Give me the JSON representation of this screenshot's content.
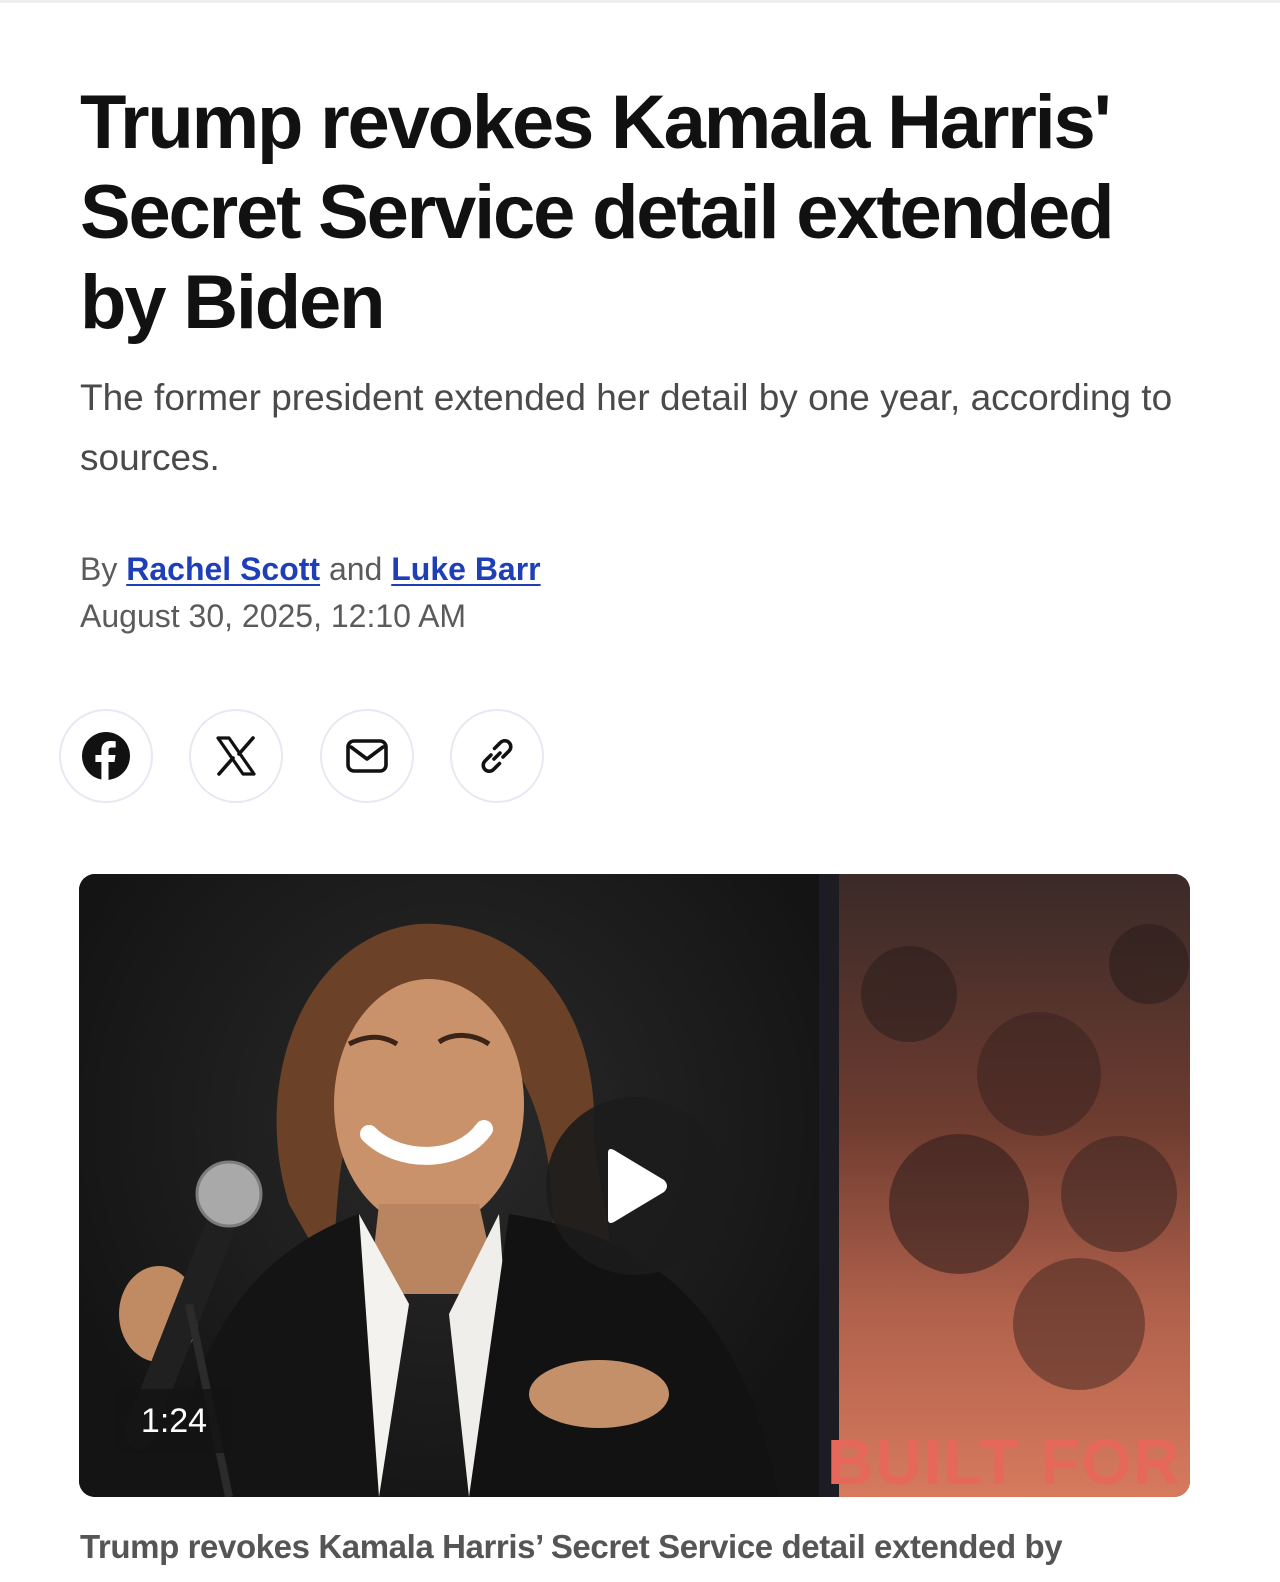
{
  "article": {
    "headline": "Trump revokes Kamala Harris' Secret Service detail extended by Biden",
    "dek": "The former president extended her detail by one year, according to sources.",
    "byline": {
      "prefix": "By",
      "author1": "Rachel Scott",
      "conjunction": "and",
      "author2": "Luke Barr"
    },
    "date": "August 30, 2025, 12:10 AM"
  },
  "share": {
    "items": [
      {
        "icon": "facebook-icon"
      },
      {
        "icon": "x-icon"
      },
      {
        "icon": "mail-icon"
      },
      {
        "icon": "link-icon"
      }
    ]
  },
  "video": {
    "duration": "1:24",
    "poster_text": "BUILT FOR US",
    "caption": "Trump revokes Kamala Harris’ Secret Service detail extended by"
  },
  "colors": {
    "link": "#1f3fb8",
    "text": "#111111",
    "muted": "#5b5b5b"
  }
}
